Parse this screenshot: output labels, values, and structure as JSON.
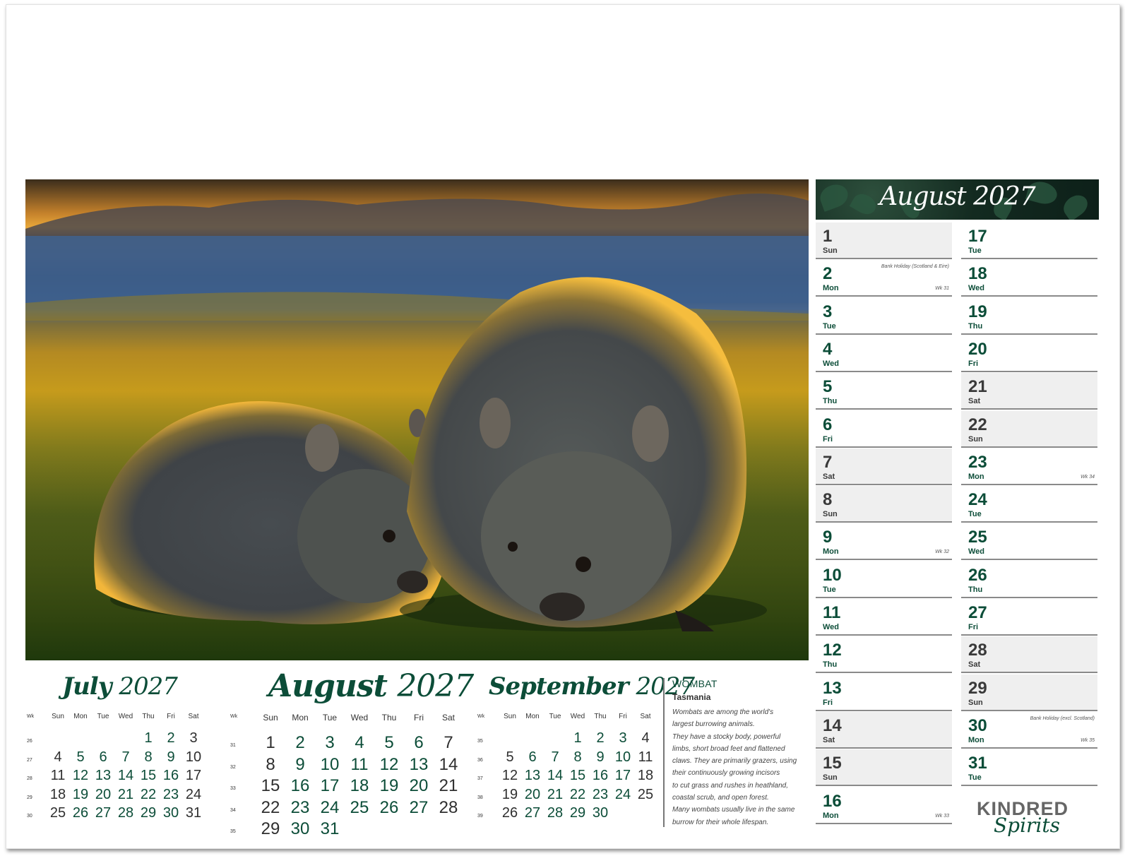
{
  "main_month": {
    "title": "August 2027",
    "days": [
      {
        "num": "1",
        "dow": "Sun",
        "note": "",
        "wk": "",
        "weekend": true
      },
      {
        "num": "2",
        "dow": "Mon",
        "note": "Bank Holiday (Scotland & Eire)",
        "wk": "Wk 31",
        "weekend": false
      },
      {
        "num": "3",
        "dow": "Tue",
        "note": "",
        "wk": "",
        "weekend": false
      },
      {
        "num": "4",
        "dow": "Wed",
        "note": "",
        "wk": "",
        "weekend": false
      },
      {
        "num": "5",
        "dow": "Thu",
        "note": "",
        "wk": "",
        "weekend": false
      },
      {
        "num": "6",
        "dow": "Fri",
        "note": "",
        "wk": "",
        "weekend": false
      },
      {
        "num": "7",
        "dow": "Sat",
        "note": "",
        "wk": "",
        "weekend": true
      },
      {
        "num": "8",
        "dow": "Sun",
        "note": "",
        "wk": "",
        "weekend": true
      },
      {
        "num": "9",
        "dow": "Mon",
        "note": "",
        "wk": "Wk 32",
        "weekend": false
      },
      {
        "num": "10",
        "dow": "Tue",
        "note": "",
        "wk": "",
        "weekend": false
      },
      {
        "num": "11",
        "dow": "Wed",
        "note": "",
        "wk": "",
        "weekend": false
      },
      {
        "num": "12",
        "dow": "Thu",
        "note": "",
        "wk": "",
        "weekend": false
      },
      {
        "num": "13",
        "dow": "Fri",
        "note": "",
        "wk": "",
        "weekend": false
      },
      {
        "num": "14",
        "dow": "Sat",
        "note": "",
        "wk": "",
        "weekend": true
      },
      {
        "num": "15",
        "dow": "Sun",
        "note": "",
        "wk": "",
        "weekend": true
      },
      {
        "num": "16",
        "dow": "Mon",
        "note": "",
        "wk": "Wk 33",
        "weekend": false
      },
      {
        "num": "17",
        "dow": "Tue",
        "note": "",
        "wk": "",
        "weekend": false
      },
      {
        "num": "18",
        "dow": "Wed",
        "note": "",
        "wk": "",
        "weekend": false
      },
      {
        "num": "19",
        "dow": "Thu",
        "note": "",
        "wk": "",
        "weekend": false
      },
      {
        "num": "20",
        "dow": "Fri",
        "note": "",
        "wk": "",
        "weekend": false
      },
      {
        "num": "21",
        "dow": "Sat",
        "note": "",
        "wk": "",
        "weekend": true
      },
      {
        "num": "22",
        "dow": "Sun",
        "note": "",
        "wk": "",
        "weekend": true
      },
      {
        "num": "23",
        "dow": "Mon",
        "note": "",
        "wk": "Wk 34",
        "weekend": false
      },
      {
        "num": "24",
        "dow": "Tue",
        "note": "",
        "wk": "",
        "weekend": false
      },
      {
        "num": "25",
        "dow": "Wed",
        "note": "",
        "wk": "",
        "weekend": false
      },
      {
        "num": "26",
        "dow": "Thu",
        "note": "",
        "wk": "",
        "weekend": false
      },
      {
        "num": "27",
        "dow": "Fri",
        "note": "",
        "wk": "",
        "weekend": false
      },
      {
        "num": "28",
        "dow": "Sat",
        "note": "",
        "wk": "",
        "weekend": true
      },
      {
        "num": "29",
        "dow": "Sun",
        "note": "",
        "wk": "",
        "weekend": true
      },
      {
        "num": "30",
        "dow": "Mon",
        "note": "Bank Holiday (excl. Scotland)",
        "wk": "Wk 35",
        "weekend": false
      },
      {
        "num": "31",
        "dow": "Tue",
        "note": "",
        "wk": "",
        "weekend": false
      }
    ]
  },
  "mini_calendars": [
    {
      "month": "July",
      "year": "2027",
      "wk_label": "Wk",
      "headers": [
        "Sun",
        "Mon",
        "Tue",
        "Wed",
        "Thu",
        "Fri",
        "Sat"
      ],
      "weeks": [
        {
          "wk": "26",
          "days": [
            "",
            "",
            "",
            "",
            "1",
            "2",
            "3"
          ]
        },
        {
          "wk": "27",
          "days": [
            "4",
            "5",
            "6",
            "7",
            "8",
            "9",
            "10"
          ]
        },
        {
          "wk": "28",
          "days": [
            "11",
            "12",
            "13",
            "14",
            "15",
            "16",
            "17"
          ]
        },
        {
          "wk": "29",
          "days": [
            "18",
            "19",
            "20",
            "21",
            "22",
            "23",
            "24"
          ]
        },
        {
          "wk": "30",
          "days": [
            "25",
            "26",
            "27",
            "28",
            "29",
            "30",
            "31"
          ]
        }
      ]
    },
    {
      "month": "August",
      "year": "2027",
      "wk_label": "Wk",
      "headers": [
        "Sun",
        "Mon",
        "Tue",
        "Wed",
        "Thu",
        "Fri",
        "Sat"
      ],
      "weeks": [
        {
          "wk": "31",
          "days": [
            "1",
            "2",
            "3",
            "4",
            "5",
            "6",
            "7"
          ]
        },
        {
          "wk": "32",
          "days": [
            "8",
            "9",
            "10",
            "11",
            "12",
            "13",
            "14"
          ]
        },
        {
          "wk": "33",
          "days": [
            "15",
            "16",
            "17",
            "18",
            "19",
            "20",
            "21"
          ]
        },
        {
          "wk": "34",
          "days": [
            "22",
            "23",
            "24",
            "25",
            "26",
            "27",
            "28"
          ]
        },
        {
          "wk": "35",
          "days": [
            "29",
            "30",
            "31",
            "",
            "",
            "",
            ""
          ]
        }
      ]
    },
    {
      "month": "September",
      "year": "2027",
      "wk_label": "Wk",
      "headers": [
        "Sun",
        "Mon",
        "Tue",
        "Wed",
        "Thu",
        "Fri",
        "Sat"
      ],
      "weeks": [
        {
          "wk": "35",
          "days": [
            "",
            "",
            "",
            "1",
            "2",
            "3",
            "4"
          ]
        },
        {
          "wk": "36",
          "days": [
            "5",
            "6",
            "7",
            "8",
            "9",
            "10",
            "11"
          ]
        },
        {
          "wk": "37",
          "days": [
            "12",
            "13",
            "14",
            "15",
            "16",
            "17",
            "18"
          ]
        },
        {
          "wk": "38",
          "days": [
            "19",
            "20",
            "21",
            "22",
            "23",
            "24",
            "25"
          ]
        },
        {
          "wk": "39",
          "days": [
            "26",
            "27",
            "28",
            "29",
            "30",
            "",
            ""
          ]
        }
      ]
    }
  ],
  "info": {
    "title": "WOMBAT",
    "subtitle": "Tasmania",
    "lines": [
      "Wombats are among the world's",
      "largest burrowing animals.",
      "They have a stocky body, powerful",
      "limbs, short broad feet and flattened",
      "claws. They are primarily grazers, using",
      "their continuously growing incisors",
      "to cut grass and rushes in heathland,",
      "coastal scrub, and open forest.",
      "Many wombats usually live in the same",
      "burrow for their whole lifespan."
    ]
  },
  "brand": {
    "line1": "KINDRED",
    "line2": "Spirits"
  },
  "photo": {
    "subject": "two wombats grazing at sunset"
  },
  "colors": {
    "accent": "#0c4d38",
    "weekend_text": "#3a3a3a",
    "shade": "#efefef"
  }
}
